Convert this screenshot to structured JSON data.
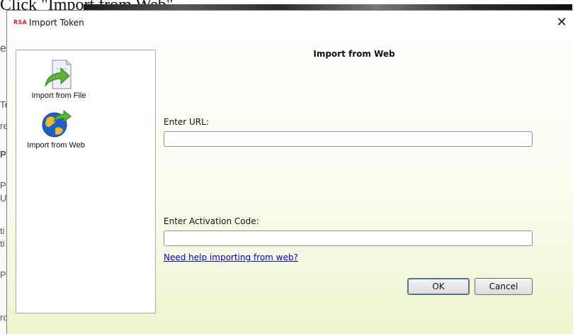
{
  "background": {
    "heading": "Click \"Import from Web\"",
    "side_letters": [
      "e",
      "Te",
      "re",
      "P",
      "P",
      "U",
      "ti",
      "ti",
      "P",
      "ro"
    ]
  },
  "dialog": {
    "logo_text": "RSA",
    "title": "Import Token",
    "close_symbol": "✕"
  },
  "sidebar": {
    "items": [
      {
        "label": "Import from File",
        "icon": "import-file-icon"
      },
      {
        "label": "Import from Web",
        "icon": "globe-import-icon"
      }
    ]
  },
  "content": {
    "title": "Import from Web",
    "url_label": "Enter URL:",
    "url_value": "",
    "activation_label": "Enter Activation Code:",
    "activation_value": "",
    "help_link": "Need help importing from web?",
    "ok_label": "OK",
    "cancel_label": "Cancel"
  },
  "colors": {
    "rsa_red": "#cc1f2c",
    "link_blue": "#0000cc",
    "panel_gradient_bottom": "#eef4cf"
  }
}
